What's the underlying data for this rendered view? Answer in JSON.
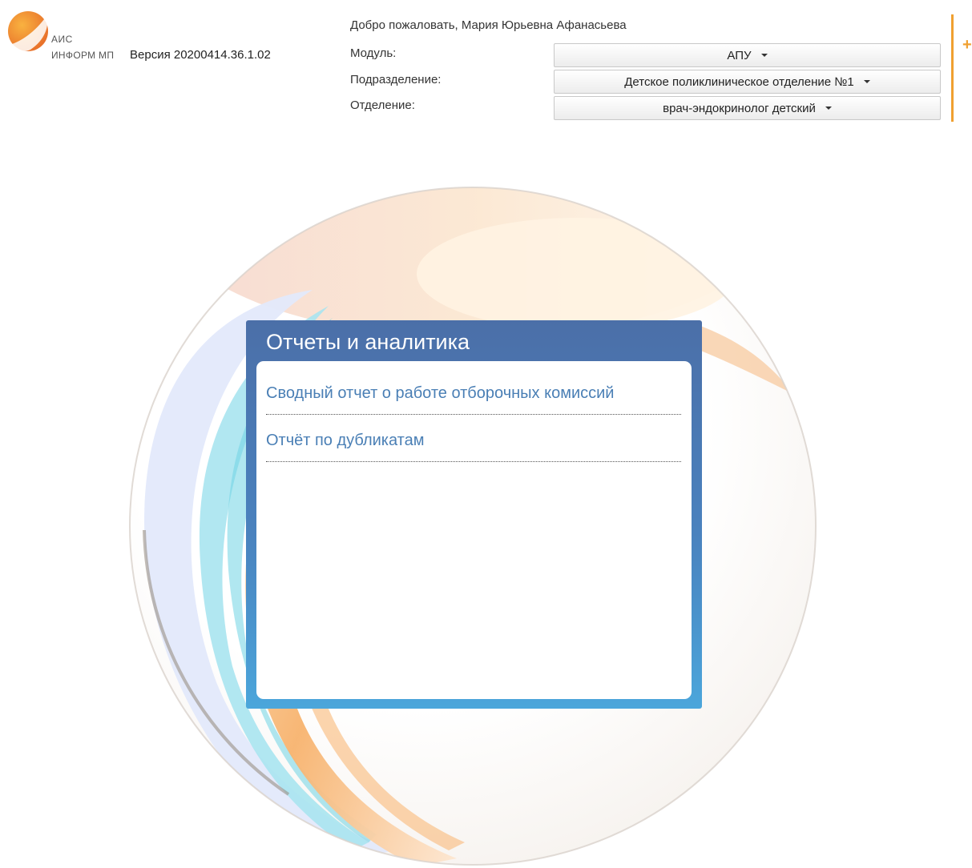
{
  "header": {
    "logo": {
      "line1": "АИС",
      "line2": "ИНФОРМ МП"
    },
    "version": "Версия 20200414.36.1.02",
    "welcome": "Добро пожаловать, Мария Юрьевна Афанасьева",
    "fields": {
      "module": {
        "label": "Модуль:",
        "value": "АПУ"
      },
      "division": {
        "label": "Подразделение:",
        "value": "Детское поликлиническое отделение №1"
      },
      "department": {
        "label": "Отделение:",
        "value": "врач-эндокринолог детский"
      }
    },
    "accent_color": "#f0a030",
    "plus_icon": "+"
  },
  "panel": {
    "title": "Отчеты и аналитика",
    "links": [
      {
        "label": "Сводный отчет о работе отборочных комиссий"
      },
      {
        "label": "Отчёт по дубликатам"
      }
    ],
    "colors": {
      "header": "#4b6fa8",
      "link": "#4a7fb5"
    }
  }
}
